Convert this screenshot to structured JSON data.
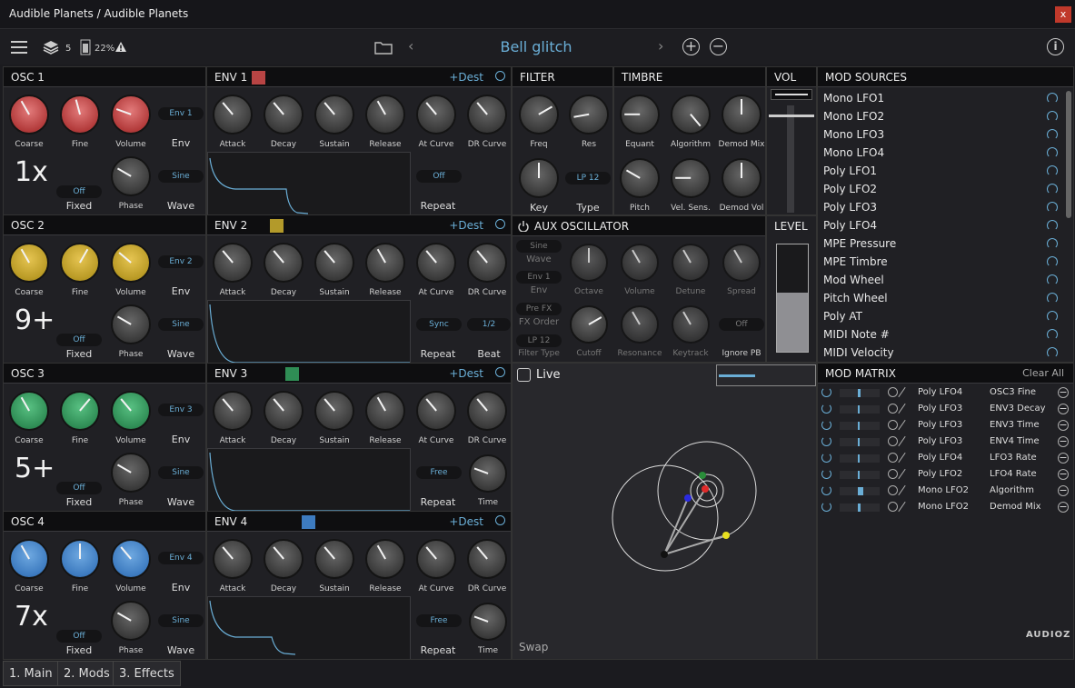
{
  "window": {
    "title": "Audible Planets / Audible Planets",
    "close": "x"
  },
  "toolbar": {
    "voices": "5",
    "cpu": "22%",
    "preset": "Bell glitch",
    "prev": "‹",
    "next": "›",
    "plus": "+",
    "minus": "−",
    "info": "i"
  },
  "osc": [
    {
      "title": "OSC 1",
      "ratio": "1x",
      "env": "Env 1",
      "wave": "Sine",
      "fixed": "Off",
      "color": "#b33b3b"
    },
    {
      "title": "OSC 2",
      "ratio": "9+",
      "env": "Env 2",
      "wave": "Sine",
      "fixed": "Off",
      "color": "#b99a25"
    },
    {
      "title": "OSC 3",
      "ratio": "5+",
      "env": "Env 3",
      "wave": "Sine",
      "fixed": "Off",
      "color": "#2f8d55"
    },
    {
      "title": "OSC 4",
      "ratio": "7x",
      "env": "Env 4",
      "wave": "Sine",
      "fixed": "Off",
      "color": "#3d7bc0"
    }
  ],
  "osc_labels": {
    "coarse": "Coarse",
    "fine": "Fine",
    "volume": "Volume",
    "env": "Env",
    "phase": "Phase",
    "wave": "Wave",
    "fixed": "Fixed"
  },
  "env": [
    {
      "title": "ENV 1",
      "dest": "+Dest",
      "color": "#b84444",
      "mode": "Off",
      "mode_label": "Repeat"
    },
    {
      "title": "ENV 2",
      "dest": "+Dest",
      "color": "#b39a2a",
      "mode": "Sync",
      "mode_label": "Repeat",
      "beat": "1/2",
      "beat_label": "Beat"
    },
    {
      "title": "ENV 3",
      "dest": "+Dest",
      "color": "#2f8d55",
      "mode": "Free",
      "mode_label": "Repeat",
      "time_label": "Time"
    },
    {
      "title": "ENV 4",
      "dest": "+Dest",
      "color": "#3d7bc0",
      "mode": "Free",
      "mode_label": "Repeat",
      "time_label": "Time"
    }
  ],
  "env_labels": {
    "attack": "Attack",
    "decay": "Decay",
    "sustain": "Sustain",
    "release": "Release",
    "atcurve": "At Curve",
    "drcurve": "DR Curve"
  },
  "filter": {
    "title": "FILTER",
    "freq": "Freq",
    "res": "Res",
    "key": "Key",
    "type": "Type",
    "type_value": "LP 12"
  },
  "timbre": {
    "title": "TIMBRE",
    "equant": "Equant",
    "algorithm": "Algorithm",
    "demodmix": "Demod Mix",
    "pitch": "Pitch",
    "velsens": "Vel. Sens.",
    "demodvol": "Demod Vol"
  },
  "vol": {
    "title": "VOL"
  },
  "level": {
    "title": "LEVEL",
    "level_fraction": 0.55
  },
  "aux": {
    "title": "AUX OSCILLATOR",
    "wave_value": "Sine",
    "wave": "Wave",
    "env_value": "Env 1",
    "env": "Env",
    "fxorder_value": "Pre FX",
    "fxorder": "FX Order",
    "filtertype_value": "LP 12",
    "filtertype": "Filter Type",
    "octave": "Octave",
    "volume": "Volume",
    "detune": "Detune",
    "spread": "Spread",
    "cutoff": "Cutoff",
    "resonance": "Resonance",
    "keytrack": "Keytrack",
    "ignorepb_value": "Off",
    "ignorepb": "Ignore PB"
  },
  "live": {
    "label": "Live",
    "swap": "Swap"
  },
  "mod_sources": {
    "title": "MOD SOURCES",
    "items": [
      "Mono LFO1",
      "Mono LFO2",
      "Mono LFO3",
      "Mono LFO4",
      "Poly LFO1",
      "Poly LFO2",
      "Poly LFO3",
      "Poly LFO4",
      "MPE Pressure",
      "MPE Timbre",
      "Mod Wheel",
      "Pitch Wheel",
      "Poly AT",
      "MIDI Note #",
      "MIDI Velocity"
    ]
  },
  "mod_matrix": {
    "title": "MOD MATRIX",
    "clear": "Clear All",
    "rows": [
      {
        "src": "Poly LFO4",
        "dst": "OSC3 Fine"
      },
      {
        "src": "Poly LFO3",
        "dst": "ENV3 Decay"
      },
      {
        "src": "Poly LFO3",
        "dst": "ENV3 Time"
      },
      {
        "src": "Poly LFO3",
        "dst": "ENV4 Time"
      },
      {
        "src": "Poly LFO4",
        "dst": "LFO3 Rate"
      },
      {
        "src": "Poly LFO2",
        "dst": "LFO4 Rate"
      },
      {
        "src": "Mono LFO2",
        "dst": "Algorithm"
      },
      {
        "src": "Mono LFO2",
        "dst": "Demod Mix"
      }
    ]
  },
  "tabs": [
    "1. Main",
    "2. Mods",
    "3. Effects"
  ],
  "watermark": "AUDIOZ"
}
